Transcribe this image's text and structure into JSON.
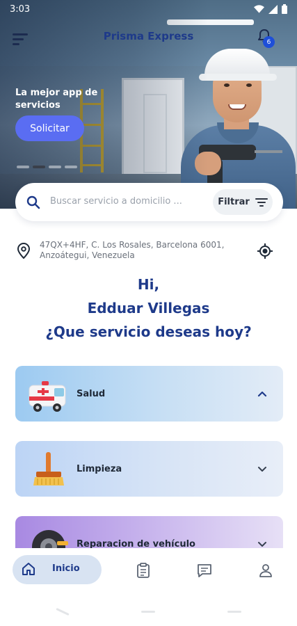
{
  "status_bar": {
    "time": "3:03"
  },
  "app_bar": {
    "title": "Prisma Express",
    "notification_count": "6"
  },
  "hero": {
    "tagline": "La mejor app de servicios",
    "cta_label": "Solicitar",
    "carousel_dots": 4,
    "active_dot": 1
  },
  "search": {
    "placeholder": "Buscar servicio a domicilio ...",
    "filter_label": "Filtrar"
  },
  "location": {
    "address": "47QX+4HF, C. Los Rosales, Barcelona 6001, Anzoátegui, Venezuela"
  },
  "greeting": {
    "line1": "Hi,",
    "line2": "Edduar Villegas",
    "line3": "¿Que servicio deseas hoy?"
  },
  "categories": [
    {
      "label": "Salud",
      "expanded": true,
      "icon": "ambulance-icon"
    },
    {
      "label": "Limpieza",
      "expanded": false,
      "icon": "broom-icon"
    },
    {
      "label": "Reparacion de vehículo",
      "expanded": false,
      "icon": "tire-icon"
    }
  ],
  "bottom_nav": {
    "home_label": "Inicio"
  },
  "colors": {
    "primary": "#1e3a8a",
    "accent": "#5a6df2",
    "badge": "#1e4fd8"
  }
}
